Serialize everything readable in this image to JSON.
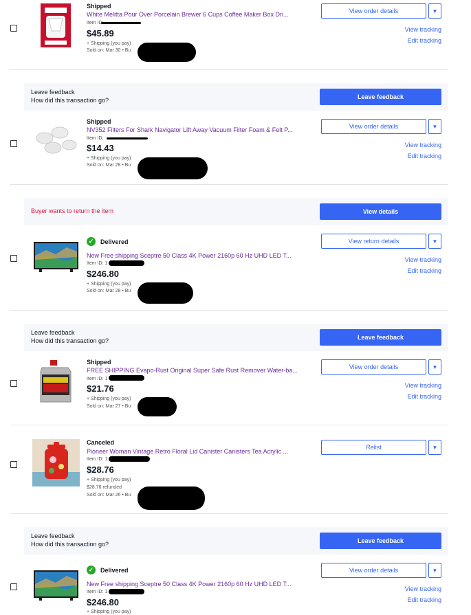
{
  "orders": [
    {
      "status": "Shipped",
      "title": "White Melitta Pour Over Porcelain Brewer 6 Cups Coffee Maker Box Dri...",
      "item_id": "Item ID:",
      "price": "$45.89",
      "shipping": "+ Shipping (you pay)",
      "sold_on": "Sold on: Mar 30 • Bu",
      "action": "View order details",
      "links": [
        "View tracking",
        "Edit tracking"
      ]
    },
    {
      "banner": {
        "title": "Leave feedback",
        "subtitle": "How did this transaction go?",
        "button": "Leave feedback"
      },
      "status": "Shipped",
      "title": "NV352 Filters For Shark Navigator Lift Away Vacuum Filter Foam & Felt P...",
      "item_id": "Item ID:",
      "price": "$14.43",
      "shipping": "+ Shipping (you pay)",
      "sold_on": "Sold on: Mar 28 • Bu",
      "action": "View order details",
      "links": [
        "View tracking",
        "Edit tracking"
      ]
    },
    {
      "banner": {
        "alert": "Buyer wants to return the item",
        "button": "View details"
      },
      "status": "Delivered",
      "title": "New Free shipping Sceptre 50 Class 4K Power 2160p 60 Hz UHD LED T...",
      "item_id": "Item ID: 1",
      "price": "$246.80",
      "shipping": "+ Shipping (you pay)",
      "sold_on": "Sold on: Mar 28 • Bu",
      "action": "View return details",
      "links": [
        "View tracking",
        "Edit tracking"
      ]
    },
    {
      "banner": {
        "title": "Leave feedback",
        "subtitle": "How did this transaction go?",
        "button": "Leave feedback"
      },
      "status": "Shipped",
      "title": "FREE SHIPPING Evapo-Rust Original Super Safe Rust Remover Water-ba...",
      "item_id": "Item ID: 1",
      "price": "$21.76",
      "shipping": "+ Shipping (you pay)",
      "sold_on": "Sold on: Mar 27 • Bu",
      "action": "View order details",
      "links": [
        "View tracking",
        "Edit tracking"
      ]
    },
    {
      "status": "Canceled",
      "title": "Pioneer Woman Vintage Retro Floral Lid Canister Canisters Tea Acrylic ...",
      "item_id": "Item ID: 1",
      "price": "$28.76",
      "shipping": "+ Shipping (you pay)",
      "refunded": "$28.76 refunded",
      "sold_on": "Sold on: Mar 26 • Bu",
      "action": "Relist",
      "links": []
    },
    {
      "banner": {
        "title": "Leave feedback",
        "subtitle": "How did this transaction go?",
        "button": "Leave feedback"
      },
      "status": "Delivered",
      "title": "New Free shipping Sceptre 50 Class 4K Power 2160p 60 Hz UHD LED T...",
      "item_id": "Item ID: 1",
      "price": "$246.80",
      "shipping": "+ Shipping (you pay)",
      "action": "View order details",
      "links": [
        "View tracking",
        "Edit tracking"
      ]
    }
  ],
  "colors": {
    "accent": "#3665f3",
    "title_link": "#6b2a9b",
    "alert": "#e0103a",
    "delivered": "#26a826"
  }
}
